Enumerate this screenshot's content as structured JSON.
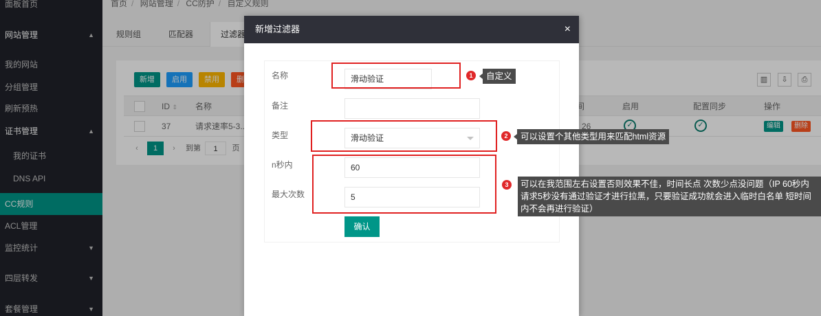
{
  "sidebar": {
    "items": [
      {
        "label": "面板首页"
      },
      {
        "label": "网站管理"
      },
      {
        "label": "我的网站"
      },
      {
        "label": "分组管理"
      },
      {
        "label": "刷新预热"
      },
      {
        "label": "证书管理"
      },
      {
        "label": "我的证书"
      },
      {
        "label": "DNS API"
      },
      {
        "label": "CC规则"
      },
      {
        "label": "ACL管理"
      },
      {
        "label": "监控统计"
      },
      {
        "label": "四层转发"
      },
      {
        "label": "套餐管理"
      }
    ]
  },
  "breadcrumb": [
    "首页",
    "网站管理",
    "CC防护",
    "自定义规则"
  ],
  "tabs": [
    "规则组",
    "匹配器",
    "过滤器"
  ],
  "toolbar": {
    "add": "新增",
    "enable": "启用",
    "disable": "禁用",
    "delete": "删"
  },
  "table": {
    "headers": {
      "id": "ID",
      "name": "名称",
      "col_partial": "间",
      "enabled": "启用",
      "sync": "配置同步",
      "actions": "操作"
    },
    "row": {
      "id": "37",
      "name": "请求速率5-3...",
      "col_partial": "26",
      "edit": "编辑",
      "delete": "删除"
    }
  },
  "pager": {
    "current": "1",
    "goto": "到第",
    "page_input": "1",
    "page_suffix": "页"
  },
  "modal": {
    "title": "新增过滤器",
    "close": "×",
    "fields": {
      "name_label": "名称",
      "name_value": "滑动验证",
      "remark_label": "备注",
      "remark_value": "",
      "type_label": "类型",
      "type_value": "滑动验证",
      "seconds_label": "n秒内",
      "seconds_value": "60",
      "max_label": "最大次数",
      "max_value": "5"
    },
    "confirm": "确认"
  },
  "annotations": [
    {
      "num": "1",
      "text": "自定义"
    },
    {
      "num": "2",
      "text": "可以设置个其他类型用来匹配html资源"
    },
    {
      "num": "3",
      "line1": "可以在我范围左右设置否则效果不佳，时间长点 次数少点没问题（IP 60秒内",
      "line2": "请求5秒没有通过验证才进行拉黑，只要验证成功就会进入临时白名单 短时间",
      "line3": "内不会再进行验证）"
    }
  ],
  "colors": {
    "accent": "#009688",
    "sidebar": "#20222a",
    "header": "#2f3039",
    "annotation": "#e02020"
  }
}
